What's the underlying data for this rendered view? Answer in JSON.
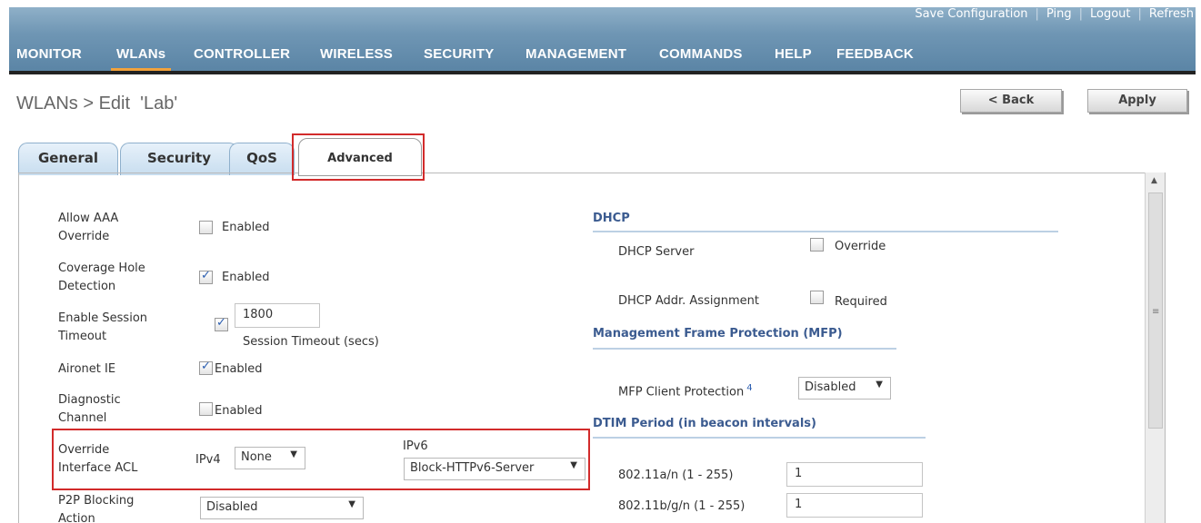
{
  "header": {
    "top_links": [
      "Save Configuration",
      "Ping",
      "Logout",
      "Refresh"
    ],
    "nav": [
      "MONITOR",
      "WLANs",
      "CONTROLLER",
      "WIRELESS",
      "SECURITY",
      "MANAGEMENT",
      "COMMANDS",
      "HELP",
      "FEEDBACK"
    ],
    "active_nav": "WLANs"
  },
  "page": {
    "title": "WLANs > Edit  'Lab'",
    "back_label": "< Back",
    "apply_label": "Apply"
  },
  "tabs": [
    "General",
    "Security",
    "QoS",
    "Advanced"
  ],
  "selected_tab": "Advanced",
  "left": {
    "aaa_label": [
      "Allow AAA",
      "Override"
    ],
    "aaa_value": "Enabled",
    "aaa_checked": false,
    "coverage_label": [
      "Coverage Hole",
      "Detection"
    ],
    "coverage_value": "Enabled",
    "coverage_checked": true,
    "session_label": [
      "Enable Session",
      "Timeout"
    ],
    "session_timeout": "1800",
    "session_checked": true,
    "session_caption": "Session Timeout (secs)",
    "aironet_label": "Aironet IE",
    "aironet_value": "Enabled",
    "aironet_checked": true,
    "diag_label": [
      "Diagnostic",
      "Channel"
    ],
    "diag_value": "Enabled",
    "diag_checked": false,
    "acl_label": [
      "Override",
      "Interface ACL"
    ],
    "ipv4_label": "IPv4",
    "ipv4_value": "None",
    "ipv6_label": "IPv6",
    "ipv6_value": "Block-HTTPv6-Server",
    "p2p_label": [
      "P2P Blocking",
      "Action"
    ],
    "p2p_value": "Disabled"
  },
  "right": {
    "dhcp_title": "DHCP",
    "dhcp_server_label": "DHCP Server",
    "dhcp_server_value": "Override",
    "dhcp_addr_label": "DHCP Addr. Assignment",
    "dhcp_addr_value": "Required",
    "mfp_title": "Management Frame Protection (MFP)",
    "mfp_label": "MFP Client Protection",
    "mfp_footnote": "4",
    "mfp_value": "Disabled",
    "dtim_title": "DTIM Period (in beacon intervals)",
    "dtim_a_label": "802.11a/n (1 - 255)",
    "dtim_a_value": "1",
    "dtim_bg_label": "802.11b/g/n (1 - 255)",
    "dtim_bg_value": "1"
  },
  "colors": {
    "highlight": "#d22b2b",
    "section": "#3b5b90",
    "nav_accent": "#f2a23a"
  }
}
